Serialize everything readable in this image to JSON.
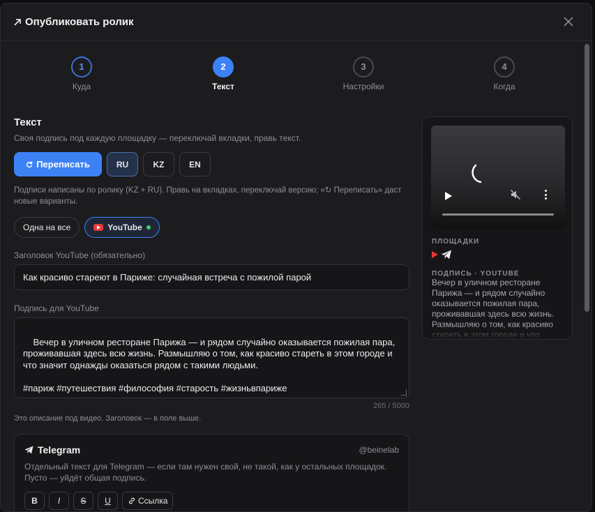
{
  "modal": {
    "title": "Опубликовать ролик",
    "title_icon": "arrow-up-right-icon",
    "close_icon": "close-icon"
  },
  "stepper": {
    "steps": [
      {
        "num": "1",
        "label": "Куда",
        "state": "done"
      },
      {
        "num": "2",
        "label": "Текст",
        "state": "active"
      },
      {
        "num": "3",
        "label": "Настройки",
        "state": "pending"
      },
      {
        "num": "4",
        "label": "Когда",
        "state": "pending"
      }
    ]
  },
  "text_section": {
    "title": "Текст",
    "description": "Своя подпись под каждую площадку — переключай вкладки, правь текст.",
    "rewrite_label": "Переписать",
    "languages": [
      {
        "label": "RU",
        "active": true
      },
      {
        "label": "KZ",
        "active": false
      },
      {
        "label": "EN",
        "active": false
      }
    ],
    "hint": "Подписи написаны по ролику (KZ + RU). Правь на вкладках, переключай версию; «↻ Переписать» даст новые варианты."
  },
  "platform_chips": {
    "all_label": "Одна на все",
    "youtube_label": "YouTube"
  },
  "youtube": {
    "title_label": "Заголовок YouTube (обязательно)",
    "title_value": "Как красиво стареют в Париже: случайная встреча с пожилой парой",
    "caption_label": "Подпись для YouTube",
    "caption_value": "Вечер в уличном ресторане Парижа — и рядом случайно оказывается пожилая пара, проживавшая здесь всю жизнь. Размышляю о том, как красиво стареть в этом городе и что значит однажды оказаться рядом с такими людьми.\n\n#париж #путешествия #философия #старость #жизньвпариже",
    "counter": "265 / 5000",
    "note": "Это описание под видео. Заголовок — в поле выше."
  },
  "telegram": {
    "title": "Telegram",
    "handle": "@beinelab",
    "description": "Отдельный текст для Telegram — если там нужен свой, не такой, как у остальных площадок. Пусто — уйдёт общая подпись.",
    "format_buttons": [
      "B",
      "I",
      "S",
      "U"
    ],
    "link_label": "Ссылка"
  },
  "preview": {
    "platforms_label": "ПЛОЩАДКИ",
    "caption_label": "ПОДПИСЬ · YOUTUBE",
    "caption_text": "Вечер в уличном ресторане Парижа — и рядом случайно оказывается пожилая пара, проживавшая здесь всю жизнь. Размышляю о том, как красиво стареть в этом городе и что"
  },
  "colors": {
    "accent": "#3d82f5",
    "youtube": "#e53935",
    "online": "#3ecf6a"
  }
}
